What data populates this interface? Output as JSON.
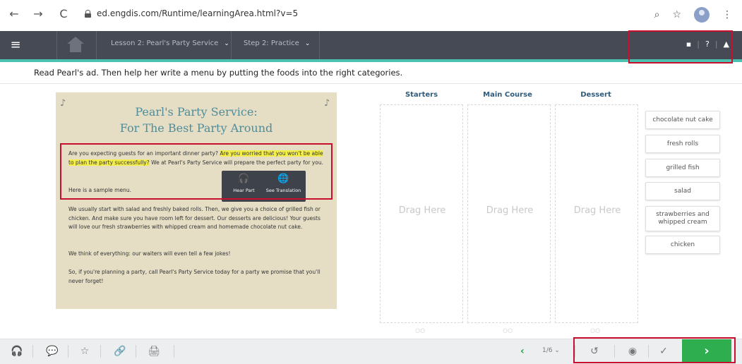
{
  "browser": {
    "back": "←",
    "forward": "→",
    "reload": "C",
    "url": "ed.engdis.com/Runtime/learningArea.html?v=5",
    "zoom_icon": "⌕",
    "star_icon": "☆",
    "menu_icon": "⋮"
  },
  "app_nav": {
    "menu_icon": "≡",
    "lesson_label": "Lesson 2: Pearl's Party Service",
    "step_label": "Step 2: Practice",
    "chevron": "⌄",
    "book_icon": "▪",
    "sep": "|",
    "help_icon": "?",
    "user_icon": "▲"
  },
  "instruction": "Read Pearl's ad. Then help her write a menu by putting the foods into the right categories.",
  "ad": {
    "title_line1": "Pearl's Party Service:",
    "title_line2": "For The Best Party Around",
    "para1_a": "Are you expecting guests for an important dinner party? ",
    "para1_hl": "Are you worried that you won't be able to plan the party successfully?",
    "para1_b": " We at Pearl's Party Service will prepare the perfect party for you.",
    "para2": "Here is a sample menu.",
    "para3": "We usually start with salad and freshly baked rolls. Then, we give you a choice of grilled fish or chicken. And make sure you have room left for dessert. Our desserts are delicious! Your guests will love our fresh strawberries with whipped cream and homemade chocolate nut cake.",
    "para4": "We think of everything: our waiters will even tell a few jokes!",
    "para5": "So, if you're planning a party, call Pearl's Party Service today for a party we promise that you'll never forget!",
    "popup": {
      "hear_icon": "🎧",
      "hear_label": "Hear Part",
      "translate_icon": "🌐",
      "translate_label": "See Translation"
    }
  },
  "columns": [
    {
      "header": "Starters",
      "placeholder": "Drag Here",
      "footer": "OO"
    },
    {
      "header": "Main Course",
      "placeholder": "Drag Here",
      "footer": "OO"
    },
    {
      "header": "Dessert",
      "placeholder": "Drag Here",
      "footer": "OO"
    }
  ],
  "choices": [
    "chocolate nut cake",
    "fresh rolls",
    "grilled fish",
    "salad",
    "strawberries and whipped cream",
    "chicken"
  ],
  "bottom_bar": {
    "tools": [
      "🎧",
      "💬",
      "☆",
      "🔗",
      "🖨"
    ],
    "prev": "‹",
    "pager": "1/6 ⌄",
    "reset_icon": "↺",
    "eye_icon": "◉",
    "check_icon": "✓",
    "next_icon": "›"
  },
  "colors": {
    "nav_bg": "#454a55",
    "accent": "#4cc3b0",
    "next_green": "#2eae4f",
    "highlight_box": "#c8102e",
    "ad_bg": "#e5dec5",
    "ad_title": "#4e8d9b"
  }
}
